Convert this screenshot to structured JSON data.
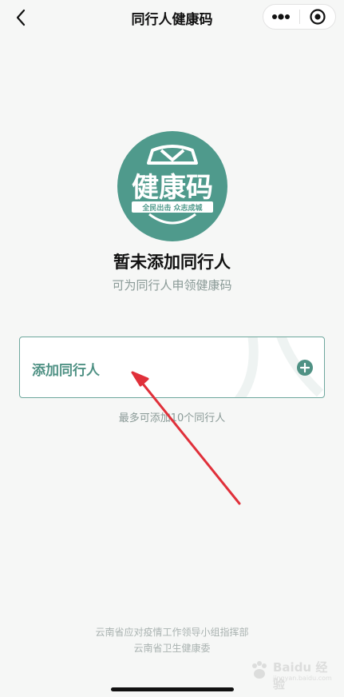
{
  "nav": {
    "title": "同行人健康码"
  },
  "logo": {
    "main_text": "健康码",
    "ribbon_text": "全民出击 众志成城"
  },
  "empty_state": {
    "title": "暂未添加同行人",
    "subtitle": "可为同行人申领健康码"
  },
  "add_card": {
    "label": "添加同行人"
  },
  "limit_note": "最多可添加10个同行人",
  "footer": {
    "line1": "云南省应对疫情工作领导小组指挥部",
    "line2": "云南省卫生健康委"
  },
  "watermark": {
    "text": "Baidu 经验",
    "url": "jingyan.baidu.com"
  },
  "colors": {
    "brand": "#4f9184",
    "logo_bg": "#4f9a8c",
    "arrow": "#e0303a"
  },
  "icons": {
    "back": "chevron-left-icon",
    "more": "more-dots-icon",
    "close": "target-circle-icon",
    "add": "plus-circle-icon"
  }
}
